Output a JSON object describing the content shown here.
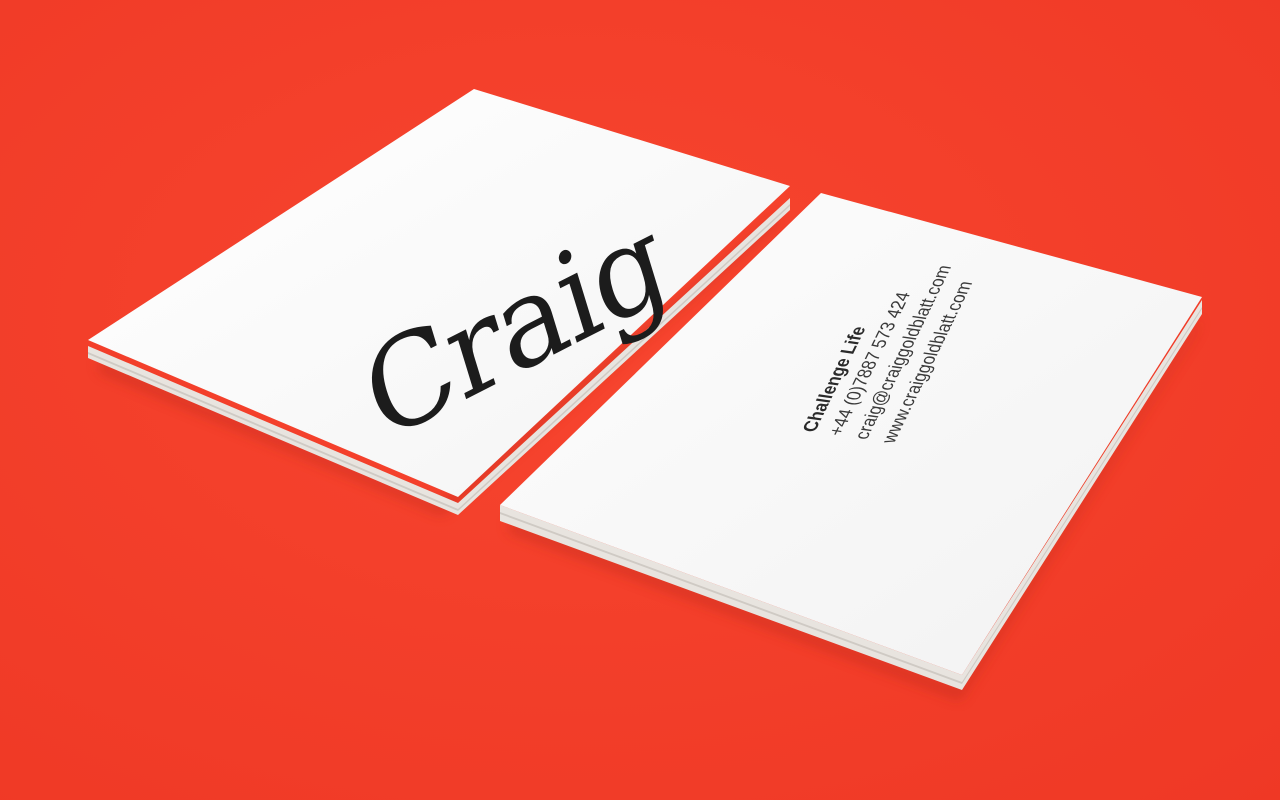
{
  "scene": {
    "background_color": "#f53e2a",
    "card_color": "#fbfbfb",
    "card_edge_color": "#e9e6e2",
    "shadow_color": "#c52a1a"
  },
  "front_card": {
    "logo_text": "Craig"
  },
  "back_card": {
    "company": "Challenge Life",
    "phone": "+44 (0)7887 573 424",
    "email": "craig@craiggoldblatt.com",
    "website": "www.craiggoldblatt.com"
  }
}
